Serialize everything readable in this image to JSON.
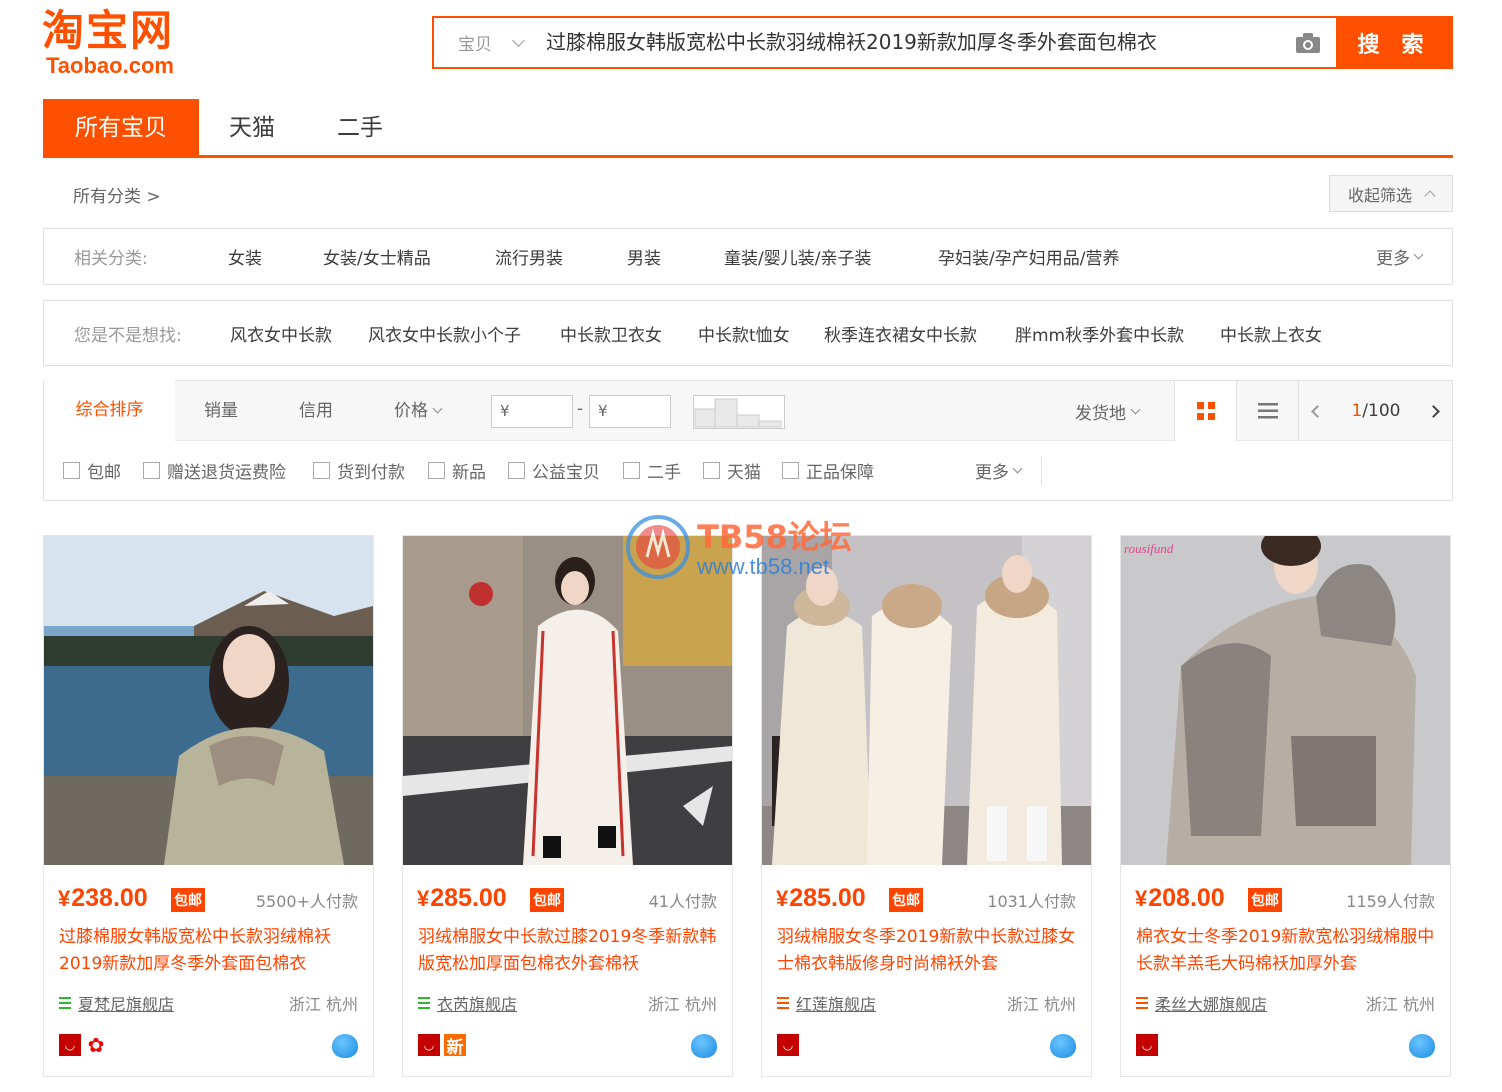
{
  "logo": {
    "cn": "淘宝网",
    "en": "Taobao.com"
  },
  "search": {
    "scope": "宝贝",
    "query": "过膝棉服女韩版宽松中长款羽绒棉袄2019新款加厚冬季外套面包棉衣",
    "button": "搜 索"
  },
  "tabs": [
    "所有宝贝",
    "天猫",
    "二手"
  ],
  "breadcrumb": "所有分类 >",
  "collapse_label": "收起筛选",
  "related": {
    "label": "相关分类:",
    "items": [
      "女装",
      "女装/女士精品",
      "流行男装",
      "男装",
      "童装/婴儿装/亲子装",
      "孕妇装/孕产妇用品/营养"
    ],
    "more": "更多"
  },
  "suggest": {
    "label": "您是不是想找:",
    "items": [
      "风衣女中长款",
      "风衣女中长款小个子",
      "中长款卫衣女",
      "中长款t恤女",
      "秋季连衣裙女中长款",
      "胖mm秋季外套中长款",
      "中长款上衣女"
    ]
  },
  "sort": {
    "items": [
      "综合排序",
      "销量",
      "信用",
      "价格"
    ],
    "price_min": "¥",
    "price_max": "¥",
    "dash": "-",
    "ship_from": "发货地",
    "page_current": "1",
    "page_total": "/100"
  },
  "filters": {
    "items": [
      "包邮",
      "赠送退货运费险",
      "货到付款",
      "新品",
      "公益宝贝",
      "二手",
      "天猫",
      "正品保障"
    ],
    "more": "更多"
  },
  "watermark": {
    "title": "TB58论坛",
    "url": "www.tb58.net"
  },
  "products": [
    {
      "price": "238.00",
      "currency": "¥",
      "free": "包邮",
      "sales": "5500+人付款",
      "title": "过膝棉服女韩版宽松中长款羽绒棉袄2019新款加厚冬季外套面包棉衣",
      "shop": "夏梵尼旗舰店",
      "location": "浙江 杭州",
      "badges": [
        "天",
        "flower"
      ],
      "brand": ""
    },
    {
      "price": "285.00",
      "currency": "¥",
      "free": "包邮",
      "sales": "41人付款",
      "title": "羽绒棉服女中长款过膝2019冬季新款韩版宽松加厚面包棉衣外套棉袄",
      "shop": "衣芮旗舰店",
      "location": "浙江 杭州",
      "badges": [
        "天",
        "新"
      ],
      "brand": ""
    },
    {
      "price": "285.00",
      "currency": "¥",
      "free": "包邮",
      "sales": "1031人付款",
      "title": "羽绒棉服女冬季2019新款中长款过膝女士棉衣韩版修身时尚棉袄外套",
      "shop": "红莲旗舰店",
      "location": "浙江 杭州",
      "badges": [
        "天"
      ],
      "brand": ""
    },
    {
      "price": "208.00",
      "currency": "¥",
      "free": "包邮",
      "sales": "1159人付款",
      "title": "棉衣女士冬季2019新款宽松羽绒棉服中长款羊羔毛大码棉袄加厚外套",
      "shop": "柔丝大娜旗舰店",
      "location": "浙江 杭州",
      "badges": [
        "天"
      ],
      "brand": "rousifund"
    }
  ]
}
